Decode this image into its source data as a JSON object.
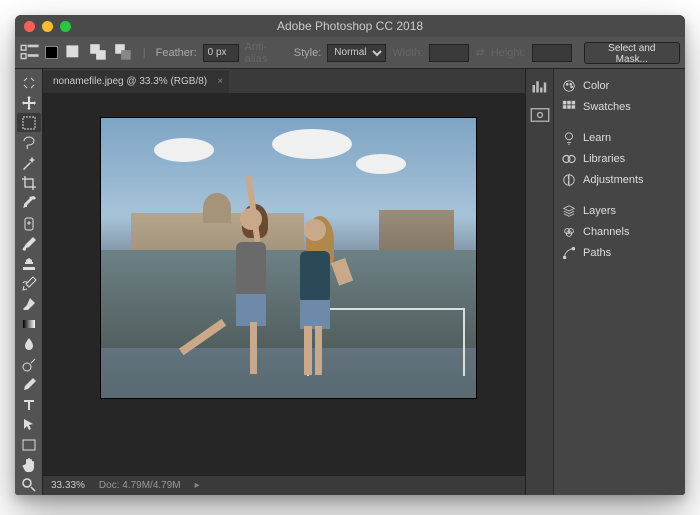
{
  "window": {
    "title": "Adobe Photoshop CC 2018"
  },
  "options": {
    "feather_label": "Feather:",
    "feather_value": "0 px",
    "antialias_label": "Anti-alias",
    "style_label": "Style:",
    "style_value": "Normal",
    "width_label": "Width:",
    "height_label": "Height:",
    "select_mask_label": "Select and Mask..."
  },
  "document": {
    "tab_label": "nonamefile.jpeg @ 33.3% (RGB/8)"
  },
  "status": {
    "zoom": "33.33%",
    "doc": "Doc: 4.79M/4.79M"
  },
  "panels": {
    "color": "Color",
    "swatches": "Swatches",
    "learn": "Learn",
    "libraries": "Libraries",
    "adjustments": "Adjustments",
    "layers": "Layers",
    "channels": "Channels",
    "paths": "Paths"
  },
  "tools": [
    "move",
    "rectangular-marquee",
    "lasso",
    "magic-wand",
    "crop",
    "eyedropper",
    "healing-brush",
    "brush",
    "clone-stamp",
    "history-brush",
    "eraser",
    "gradient",
    "blur",
    "dodge",
    "pen",
    "horizontal-type",
    "path-selection",
    "rectangle",
    "hand",
    "zoom"
  ]
}
